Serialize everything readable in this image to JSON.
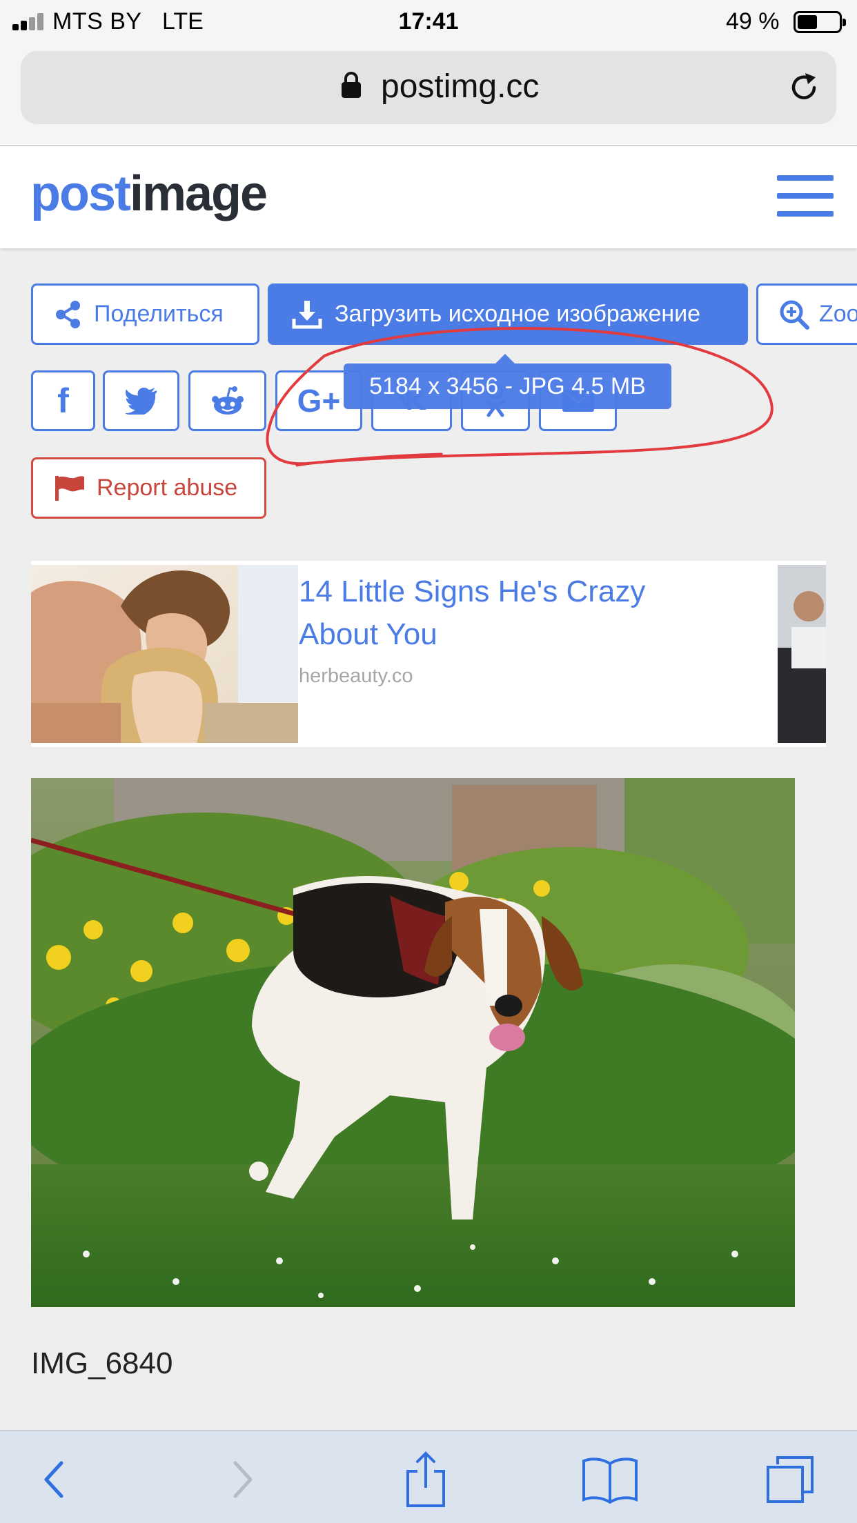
{
  "status_bar": {
    "carrier": "MTS BY",
    "network": "LTE",
    "time": "17:41",
    "battery": "49 %",
    "battery_level": 0.49
  },
  "browser": {
    "url": "postimg.cc"
  },
  "site": {
    "logo_part1": "post",
    "logo_part2": "image",
    "brand_color": "#4b7be5"
  },
  "actions": {
    "share_label": "Поделиться",
    "download_label": "Загрузить исходное изображение",
    "zoom_label": "Zoom",
    "tooltip": "5184 x 3456 - JPG 4.5 MB",
    "report_label": "Report abuse"
  },
  "social": [
    {
      "name": "facebook-icon",
      "glyph": "f"
    },
    {
      "name": "twitter-icon"
    },
    {
      "name": "reddit-icon"
    },
    {
      "name": "google-plus-icon",
      "glyph": "G+"
    },
    {
      "name": "vk-icon"
    },
    {
      "name": "odnoklassniki-icon"
    },
    {
      "name": "email-icon"
    }
  ],
  "ad": {
    "title": "14 Little Signs He's Crazy About You",
    "source": "herbeauty.co"
  },
  "image": {
    "caption": "IMG_6840"
  }
}
